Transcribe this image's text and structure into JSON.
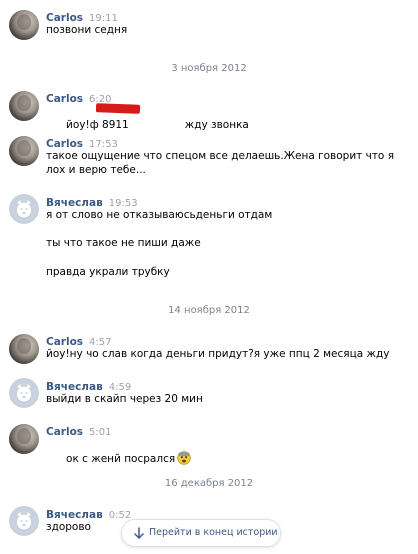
{
  "messages": [
    {
      "name": "Carlos",
      "time": "19:11",
      "lines": [
        "позвони седня"
      ]
    },
    {
      "name": "Carlos",
      "time": "6:20",
      "lines": [
        "йоу!ф 8911",
        "жду звонка"
      ]
    },
    {
      "name": "Carlos",
      "time": "17:53",
      "lines": [
        "такое ощущение что спецом все делаешь.Жена говорит что я",
        "лох и верю тебе..."
      ]
    },
    {
      "name": "Вячеслав",
      "time": "19:53",
      "lines": [
        "я от слово не отказываюсьденьги отдам",
        "ты что такое не пиши даже",
        "правда украли трубку"
      ]
    },
    {
      "name": "Carlos",
      "time": "4:57",
      "lines": [
        "йоу!ну чо слав когда деньги придут?я уже ппц 2 месяца жду"
      ]
    },
    {
      "name": "Вячеслав",
      "time": "4:59",
      "lines": [
        "выйди в скайп через 20 мин"
      ]
    },
    {
      "name": "Carlos",
      "time": "5:01",
      "lines": [
        "ок с женй посрался"
      ]
    },
    {
      "name": "Вячеслав",
      "time": "0:52",
      "lines": [
        "здорово"
      ]
    }
  ],
  "dates": [
    "3 ноября 2012",
    "14 ноября 2012",
    "16 декабря 2012"
  ],
  "jump_button": {
    "label": "Перейти в конец истории",
    "icon": "arrow-down-icon"
  },
  "icons": {
    "emoji": "fearful-face-emoji",
    "avatar_default": "dog-avatar-icon"
  },
  "colors": {
    "author": "#3b5a84",
    "time": "#9aa3ad",
    "date": "#7a8390",
    "redaction": "#d61a1a"
  }
}
